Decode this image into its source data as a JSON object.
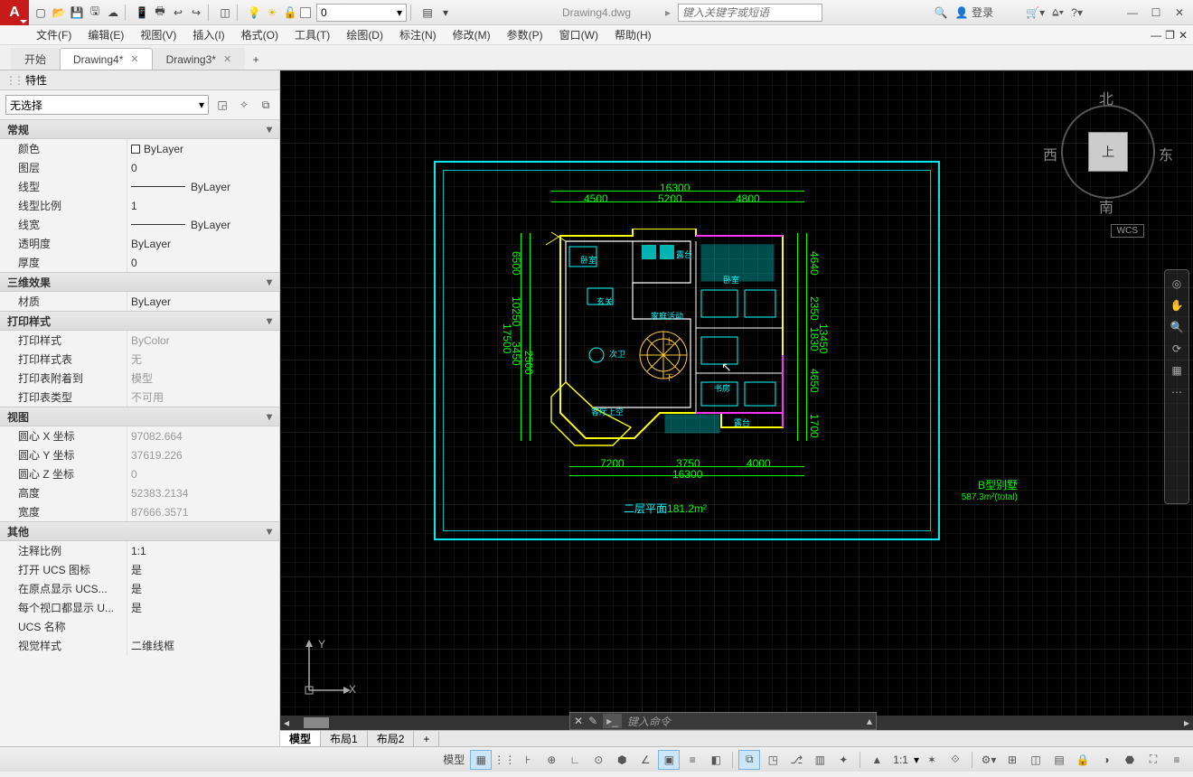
{
  "title": "Drawing4.dwg",
  "search_placeholder": "键入关键字或短语",
  "login_label": "登录",
  "menus": [
    "文件(F)",
    "编辑(E)",
    "视图(V)",
    "插入(I)",
    "格式(O)",
    "工具(T)",
    "绘图(D)",
    "标注(N)",
    "修改(M)",
    "参数(P)",
    "窗口(W)",
    "帮助(H)"
  ],
  "doc_tabs": [
    {
      "label": "开始",
      "active": false,
      "closable": false
    },
    {
      "label": "Drawing4*",
      "active": true,
      "closable": true
    },
    {
      "label": "Drawing3*",
      "active": false,
      "closable": true
    }
  ],
  "layer_current": "0",
  "properties": {
    "panel_title": "特性",
    "selection": "无选择",
    "groups": [
      {
        "title": "常规",
        "rows": [
          {
            "label": "颜色",
            "value": "ByLayer",
            "swatch": true
          },
          {
            "label": "图层",
            "value": "0"
          },
          {
            "label": "线型",
            "value": "ByLayer",
            "line": true
          },
          {
            "label": "线型比例",
            "value": "1"
          },
          {
            "label": "线宽",
            "value": "ByLayer",
            "line": true
          },
          {
            "label": "透明度",
            "value": "ByLayer"
          },
          {
            "label": "厚度",
            "value": "0"
          }
        ]
      },
      {
        "title": "三维效果",
        "rows": [
          {
            "label": "材质",
            "value": "ByLayer"
          }
        ]
      },
      {
        "title": "打印样式",
        "rows": [
          {
            "label": "打印样式",
            "value": "ByColor",
            "dim": true
          },
          {
            "label": "打印样式表",
            "value": "无",
            "dim": true
          },
          {
            "label": "打印表附着到",
            "value": "模型",
            "dim": true
          },
          {
            "label": "打印表类型",
            "value": "不可用",
            "dim": true
          }
        ]
      },
      {
        "title": "视图",
        "rows": [
          {
            "label": "圆心 X 坐标",
            "value": "97082.664",
            "dim": true
          },
          {
            "label": "圆心 Y 坐标",
            "value": "37619.226",
            "dim": true
          },
          {
            "label": "圆心 Z 坐标",
            "value": "0",
            "dim": true
          },
          {
            "label": "高度",
            "value": "52383.2134",
            "dim": true
          },
          {
            "label": "宽度",
            "value": "87666.3571",
            "dim": true
          }
        ]
      },
      {
        "title": "其他",
        "rows": [
          {
            "label": "注释比例",
            "value": "1:1"
          },
          {
            "label": "打开 UCS 图标",
            "value": "是"
          },
          {
            "label": "在原点显示 UCS...",
            "value": "是"
          },
          {
            "label": "每个视口都显示 U...",
            "value": "是"
          },
          {
            "label": "UCS 名称",
            "value": ""
          },
          {
            "label": "视觉样式",
            "value": "二维线框"
          }
        ]
      }
    ]
  },
  "viewcube": {
    "top": "上",
    "n": "北",
    "s": "南",
    "e": "东",
    "w": "西",
    "wcs": "WCS"
  },
  "ucs": {
    "x": "X",
    "y": "Y"
  },
  "drawing": {
    "frame_title": "B型别墅",
    "frame_sub": "587.3m²(total)",
    "caption": "二层平面",
    "caption_area": "181.2m²",
    "dims_top": [
      "4500",
      "5200",
      "4800",
      "16300"
    ],
    "dims_left": [
      "6500",
      "10250",
      "3450",
      "17500",
      "2500"
    ],
    "dims_right": [
      "4640",
      "2350",
      "1830",
      "4650",
      "1700"
    ],
    "dims_bot": [
      "7200",
      "3750",
      "4000",
      "16300"
    ],
    "rooms": [
      "卧室",
      "露台",
      "卧室",
      "玄关",
      "次卫",
      "客厅",
      "上",
      "下",
      "书房",
      "露台",
      "客厅上空",
      "家庭活动"
    ]
  },
  "command_prompt": "键入命令",
  "layout_tabs": [
    "模型",
    "布局1",
    "布局2"
  ],
  "status": {
    "model": "模型",
    "scale": "1:1"
  }
}
